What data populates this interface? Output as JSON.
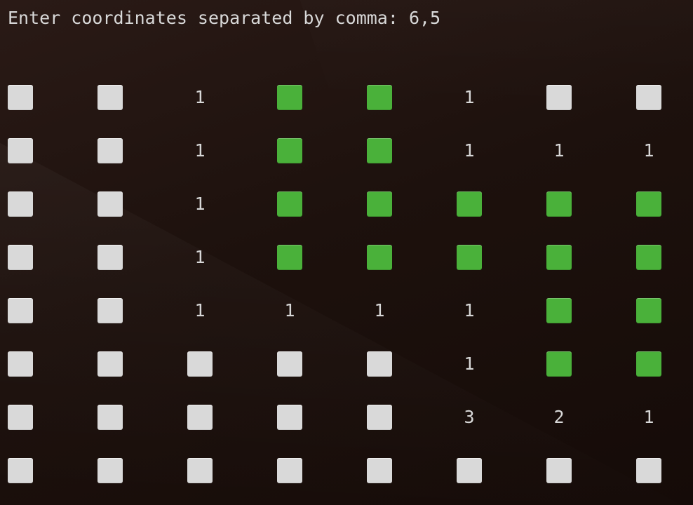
{
  "terminal": {
    "prompt": "Enter coordinates separated by comma: ",
    "input": "6,5"
  },
  "colors": {
    "hidden": "#d9d9d9",
    "empty": "#4ab13a",
    "text": "#d8d8d8",
    "background": "#1d110d"
  },
  "legend": {
    "H": "hidden-square-icon",
    "E": "green-square-icon"
  },
  "board": {
    "rows": [
      [
        "H",
        "H",
        "1",
        "E",
        "E",
        "1",
        "H",
        "H"
      ],
      [
        "H",
        "H",
        "1",
        "E",
        "E",
        "1",
        "1",
        "1"
      ],
      [
        "H",
        "H",
        "1",
        "E",
        "E",
        "E",
        "E",
        "E"
      ],
      [
        "H",
        "H",
        "1",
        "E",
        "E",
        "E",
        "E",
        "E"
      ],
      [
        "H",
        "H",
        "1",
        "1",
        "1",
        "1",
        "E",
        "E"
      ],
      [
        "H",
        "H",
        "H",
        "H",
        "H",
        "1",
        "E",
        "E"
      ],
      [
        "H",
        "H",
        "H",
        "H",
        "H",
        "3",
        "2",
        "1"
      ],
      [
        "H",
        "H",
        "H",
        "H",
        "H",
        "H",
        "H",
        "H"
      ]
    ]
  }
}
